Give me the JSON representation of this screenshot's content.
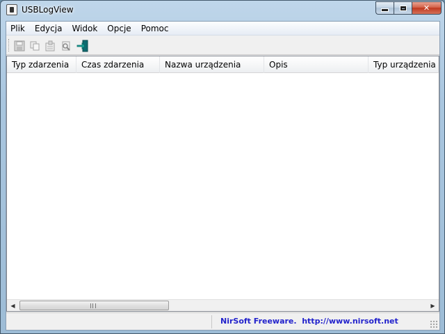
{
  "window": {
    "title": "USBLogView"
  },
  "menu": [
    "Plik",
    "Edycja",
    "Widok",
    "Opcje",
    "Pomoc"
  ],
  "toolbar": {
    "buttons": [
      "save-icon",
      "copy-icon",
      "properties-icon",
      "find-icon",
      "exit-icon"
    ]
  },
  "list": {
    "columns": [
      "Typ zdarzenia",
      "Czas zdarzenia",
      "Nazwa urządzenia",
      "Opis",
      "Typ urządzenia"
    ],
    "rows": []
  },
  "scrollbar": {
    "grip": "III"
  },
  "status": {
    "link_text": "NirSoft Freeware.  http://www.nirsoft.net"
  },
  "colors": {
    "accent_link": "#2222cc",
    "exit_icon": "#1aa39a"
  }
}
